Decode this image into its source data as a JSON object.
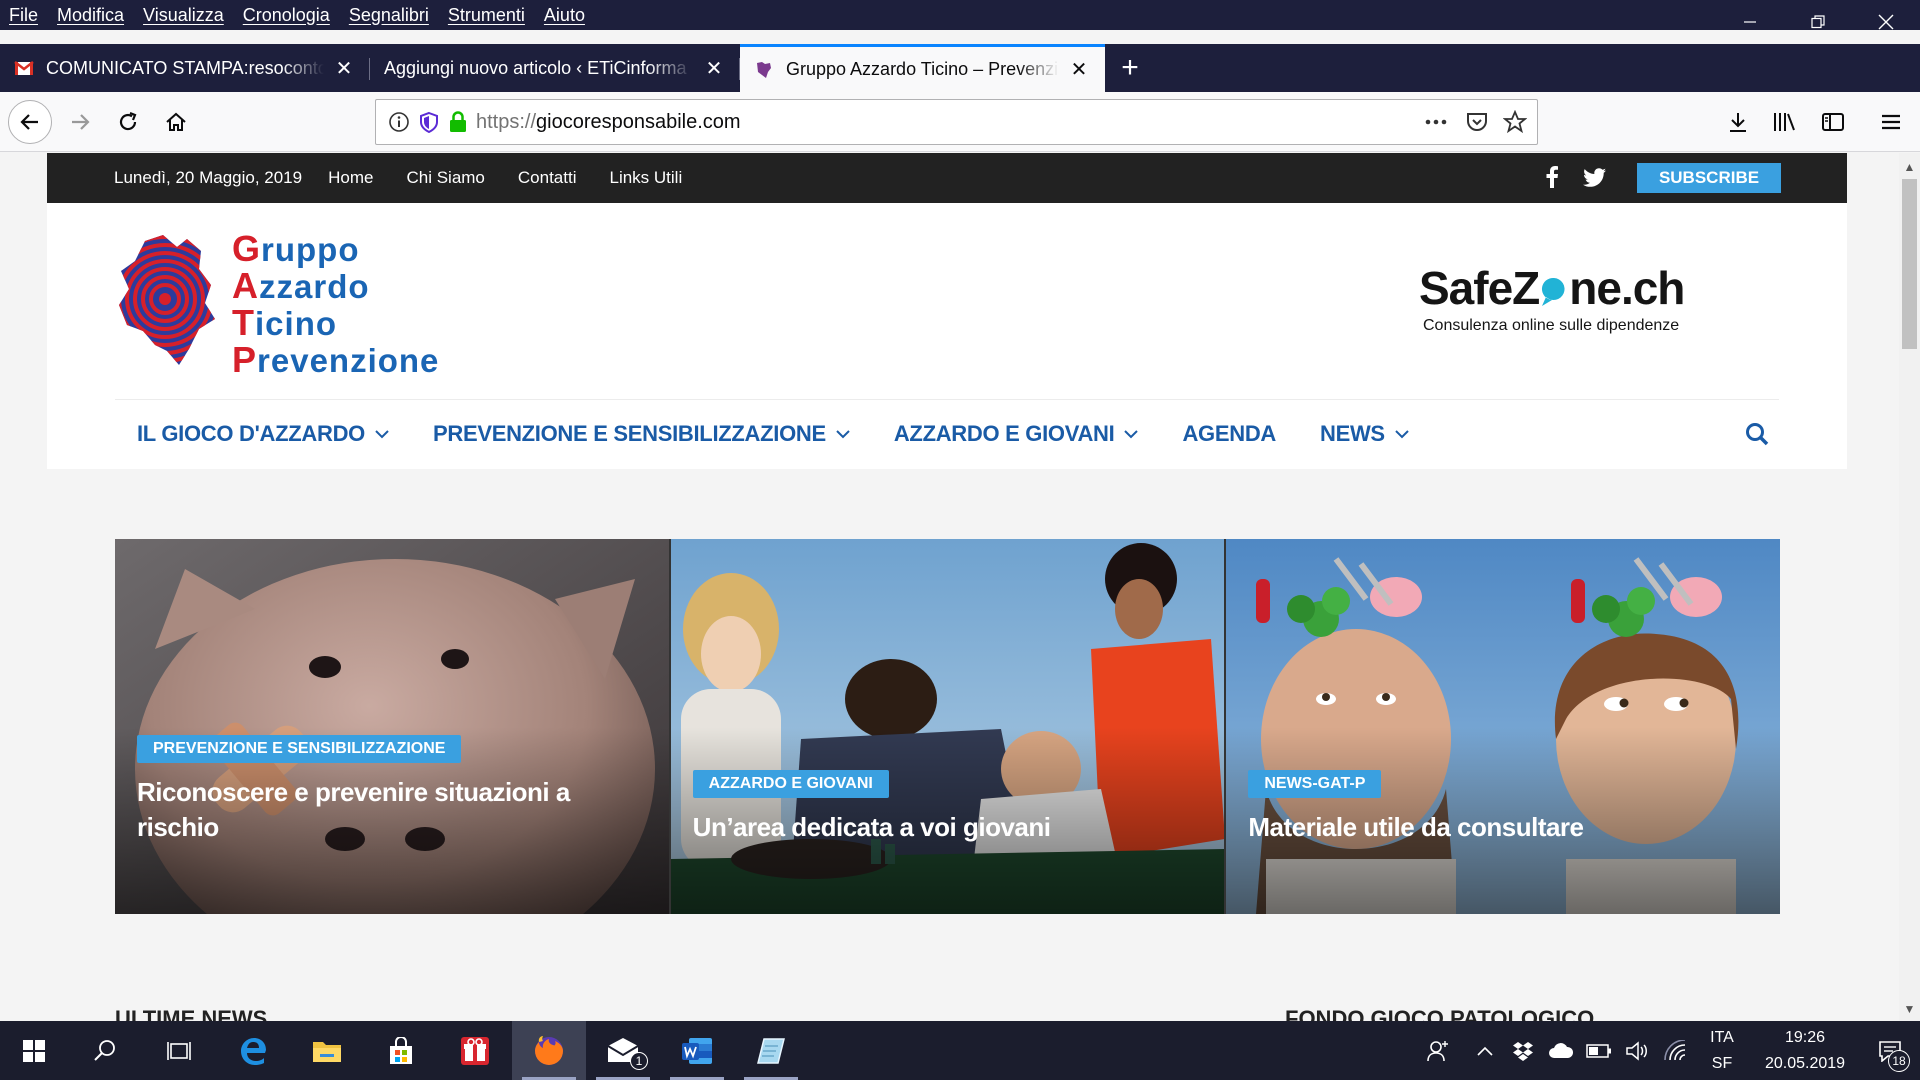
{
  "menubar": {
    "items": [
      "File",
      "Modifica",
      "Visualizza",
      "Cronologia",
      "Segnalibri",
      "Strumenti",
      "Aiuto"
    ]
  },
  "tabs": [
    {
      "title": "COMUNICATO STAMPA:resoconto",
      "active": false
    },
    {
      "title": "Aggiungi nuovo articolo ‹ ETiCinforma",
      "active": false
    },
    {
      "title": "Gruppo Azzardo Ticino – Prevenzione",
      "active": true
    }
  ],
  "url": {
    "prefix": "https://",
    "host": "giocoresponsabile.com"
  },
  "topbar": {
    "date": "Lunedì, 20 Maggio, 2019",
    "links": [
      "Home",
      "Chi Siamo",
      "Contatti",
      "Links Utili"
    ],
    "subscribe": "SUBSCRIBE"
  },
  "logo": {
    "lines": [
      {
        "cap": "G",
        "rest": "ruppo"
      },
      {
        "cap": "A",
        "rest": "zzardo"
      },
      {
        "cap": "T",
        "rest": "icino"
      },
      {
        "cap": "P",
        "rest": "revenzione"
      }
    ]
  },
  "safezone": {
    "title_a": "SafeZ",
    "title_b": "ne.ch",
    "subtitle": "Consulenza online sulle dipendenze"
  },
  "mainnav": [
    {
      "label": "IL GIOCO D'AZZARDO",
      "dropdown": true
    },
    {
      "label": "PREVENZIONE E SENSIBILIZZAZIONE",
      "dropdown": true
    },
    {
      "label": "AZZARDO E GIOVANI",
      "dropdown": true
    },
    {
      "label": "AGENDA",
      "dropdown": false
    },
    {
      "label": "NEWS",
      "dropdown": true
    }
  ],
  "slides": [
    {
      "category": "PREVENZIONE E SENSIBILIZZAZIONE",
      "title": "Riconoscere e prevenire situazioni a rischio"
    },
    {
      "category": "AZZARDO E GIOVANI",
      "title": "Un’area dedicata a voi giovani"
    },
    {
      "category": "NEWS-GAT-P",
      "title": "Materiale utile da consultare"
    }
  ],
  "below": {
    "left": "ULTIME NEWS",
    "right": "FONDO GIOCO PATOLOGICO"
  },
  "taskbar": {
    "mail_badge": "1",
    "lang_top": "ITA",
    "lang_bottom": "SF",
    "time": "19:26",
    "date": "20.05.2019",
    "notifications": "18"
  },
  "colors": {
    "accent": "#3aa0e0",
    "nav_blue": "#1a5ba6",
    "logo_red": "#d6202a",
    "logo_blue": "#1a65b4",
    "chrome_dark": "#1d1f3c"
  }
}
